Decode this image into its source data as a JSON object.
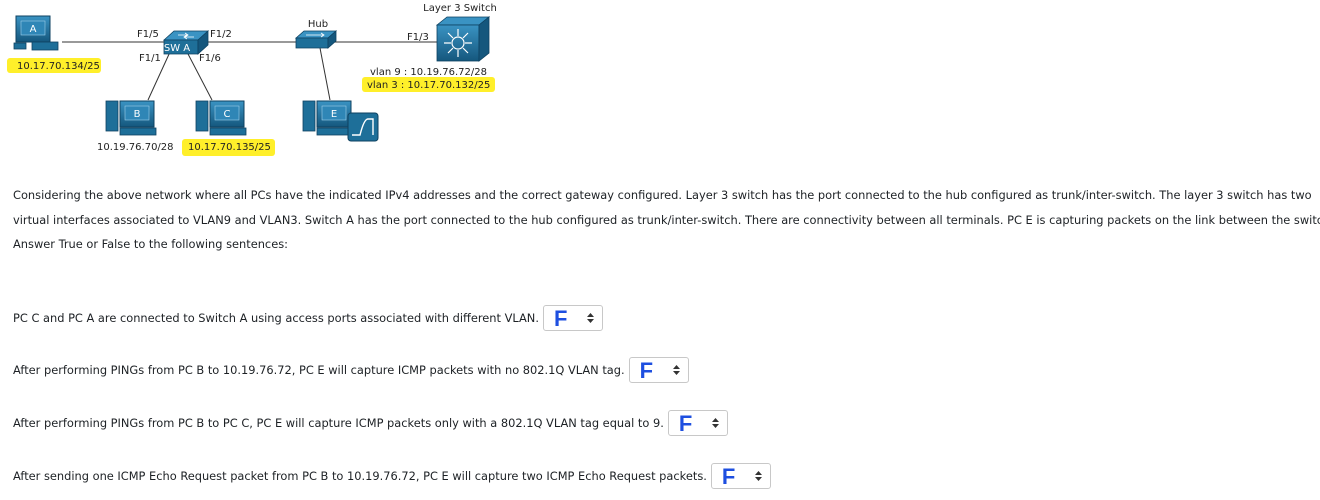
{
  "diagram": {
    "labels": {
      "hub": "Hub",
      "l3switch": "Layer 3 Switch",
      "switch_a": "SW A",
      "f15": "F1/5",
      "f12": "F1/2",
      "f11": "F1/1",
      "f16": "F1/6",
      "f13": "F1/3"
    },
    "pcs": {
      "a": {
        "letter": "A",
        "ip": "10.17.70.134/25"
      },
      "b": {
        "letter": "B",
        "ip": "10.19.76.70/28"
      },
      "c": {
        "letter": "C",
        "ip": "10.17.70.135/25"
      },
      "e": {
        "letter": "E"
      }
    },
    "vlans": {
      "vlan9": "vlan 9 : 10.19.76.72/28",
      "vlan3": "vlan 3 : 10.17.70.132/25"
    },
    "colors": {
      "device": "#1e6f99",
      "highlight": "#ffef2a",
      "answer": "#1e4fe0"
    }
  },
  "text": {
    "line1": "Considering the above network where all PCs have the indicated IPv4 addresses and the correct gateway configured. Layer 3 switch has the port connected to the hub configured as trunk/inter-switch. The layer 3 switch has two",
    "line2": "virtual interfaces associated to VLAN9 and VLAN3. Switch A has the port connected to the hub configured as trunk/inter-switch. There are connectivity between all terminals. PC E is capturing packets on the link between the switches.",
    "line3": "Answer True or False to the following sentences:"
  },
  "questions": [
    {
      "text": "PC C and PC A are connected to Switch A using access ports associated with different VLAN.",
      "answer": "F"
    },
    {
      "text": "After performing PINGs from PC B to 10.19.76.72, PC E will capture ICMP packets with no 802.1Q VLAN tag.",
      "answer": "F"
    },
    {
      "text": "After performing PINGs from PC B to PC C, PC E will capture ICMP packets only with a 802.1Q VLAN tag equal to 9.",
      "answer": "F"
    },
    {
      "text": "After sending one ICMP Echo Request packet from PC B to 10.19.76.72, PC E will capture two ICMP Echo Request packets.",
      "answer": "F"
    }
  ]
}
